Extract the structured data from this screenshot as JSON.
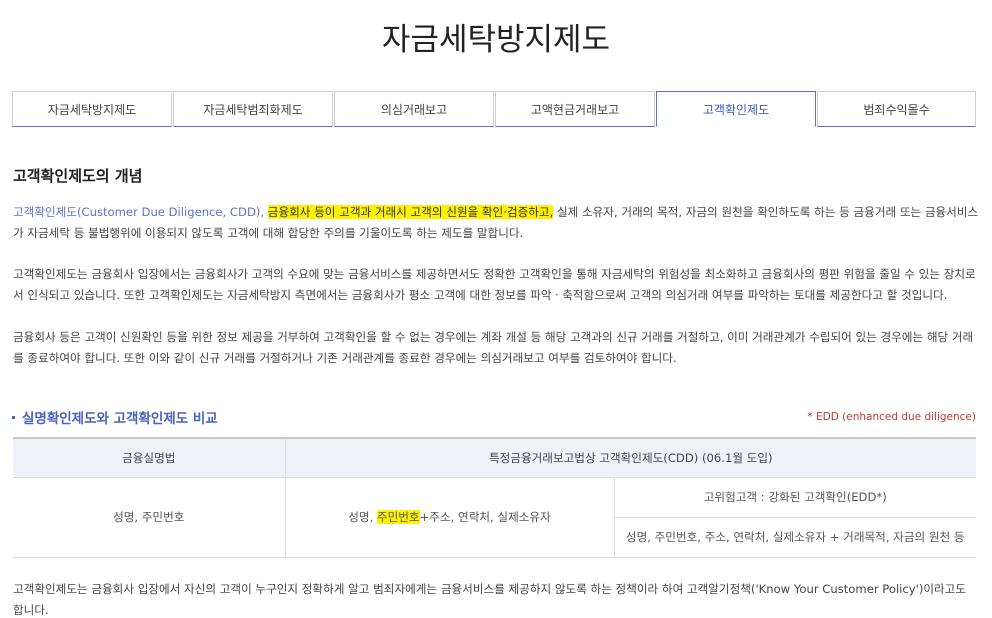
{
  "page_title": "자금세탁방지제도",
  "tabs": [
    {
      "label": "자금세탁방지제도",
      "active": false
    },
    {
      "label": "자금세탁범죄화제도",
      "active": false
    },
    {
      "label": "의심거래보고",
      "active": false
    },
    {
      "label": "고액현금거래보고",
      "active": false
    },
    {
      "label": "고객확인제도",
      "active": true
    },
    {
      "label": "범죄수익몰수",
      "active": false
    }
  ],
  "section_title": "고객확인제도의 개념",
  "para1": {
    "blue": "고객확인제도(Customer Due Diligence, CDD),",
    "highlight": "금융회사 등이 고객과 거래시 고객의 신원을 확인·검증하고,",
    "rest": " 실제 소유자, 거래의 목적, 자금의 원천을 확인하도록 하는 등 금융거래 또는 금융서비스가 자금세탁 등 불법행위에 이용되지 않도록 고객에 대해 합당한 주의를 기울이도록 하는 제도를 말합니다."
  },
  "para2": "고객확인제도는 금융회사 입장에서는 금융회사가 고객의 수요에 맞는 금융서비스를 제공하면서도 정확한 고객확인을 통해 자금세탁의 위험성을 최소화하고 금융회사의 평판 위험을 줄일 수 있는 장치로서 인식되고 있습니다. 또한 고객확인제도는 자금세탁방지 측면에서는 금융회사가 평소 고객에 대한 정보를 파악ㆍ축적함으로써 고객의 의심거래 여부를 파악하는 토대를 제공한다고 할 것입니다.",
  "para3": "금융회사 등은 고객이 신원확인 등을 위한 정보 제공을 거부하여 고객확인을 할 수 없는 경우에는 계좌 개설 등 해당 고객과의 신규 거래를 거절하고, 이미 거래관계가 수립되어 있는 경우에는 해당 거래를 종료하여야 합니다. 또한 이와 같이 신규 거래를 거절하거나 기존 거래관계를 종료한 경우에는 의심거래보고 여부를 검토하여야 합니다.",
  "compare": {
    "title": "실명확인제도와 고객확인제도 비교",
    "note": "* EDD (enhanced due diligence)",
    "col1_header": "금융실명법",
    "col2_header": "특정금융거래보고법상 고객확인제도(CDD) (06.1월 도입)",
    "col1_value": "성명, 주민번호",
    "col2_pre": "성명, ",
    "col2_highlight": "주민번호",
    "col2_post": "+주소, 연락처, 실제소유자",
    "col3_header": "고위험고객 : 강화된 고객확인(EDD*)",
    "col3_value": "성명, 주민번호, 주소, 연락처, 실제소유자 + 거래목적, 자금의 원천 등"
  },
  "footer": "고객확인제도는 금융회사 입장에서 자신의 고객이 누구인지 정확하게 알고 범죄자에게는 금융서비스를 제공하지 않도록 하는 정책이라 하여 고객알기정책('Know Your Customer Policy')이라고도 합니다."
}
